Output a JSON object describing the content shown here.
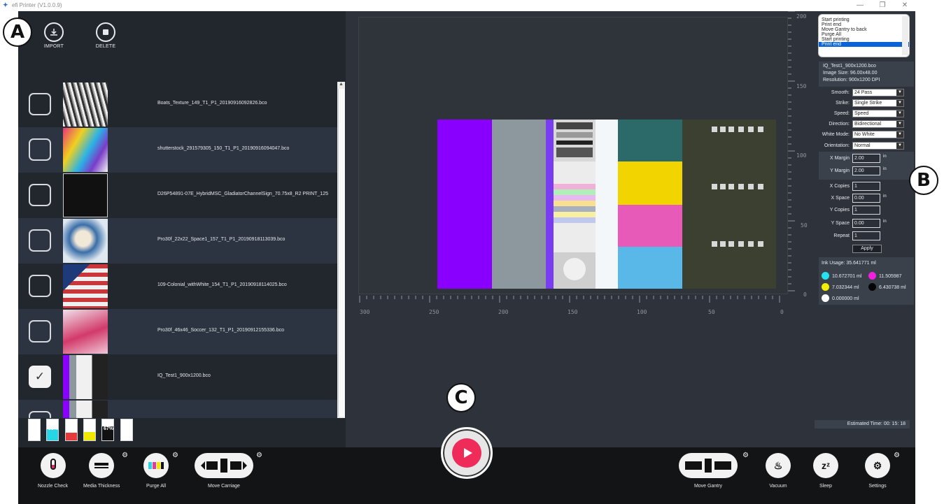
{
  "window": {
    "title": "efi Printer (V1.0.0.9)",
    "minimize": "—",
    "restore": "❐",
    "close": "✕",
    "logo": "✦"
  },
  "toolbar": {
    "import_label": "IMPORT",
    "delete_label": "DELETE",
    "import_icon": "download-icon",
    "delete_icon": "stop-square-icon"
  },
  "callouts": {
    "a": "A",
    "b": "B",
    "c": "C"
  },
  "files": [
    {
      "name": "Boats_Texture_149_T1_P1_20190916092826.bco",
      "checked": false,
      "check": ""
    },
    {
      "name": "shutterstock_291579305_150_T1_P1_20190916094047.bco",
      "checked": false,
      "check": ""
    },
    {
      "name": "D26P54891-07E_HybridMSC_GladiatorChannelSign_70.75x8_R2 PRINT_125",
      "checked": false,
      "check": ""
    },
    {
      "name": "Pro30f_22x22_Space1_157_T1_P1_20190918113039.bco",
      "checked": false,
      "check": ""
    },
    {
      "name": "109-Colonial_withWhite_154_T1_P1_20190918114025.bco",
      "checked": false,
      "check": ""
    },
    {
      "name": "Pro30f_46x46_Soccer_132_T1_P1_20190912155336.bco",
      "checked": false,
      "check": ""
    },
    {
      "name": "IQ_Test1_900x1200.bco",
      "checked": true,
      "check": "✓"
    },
    {
      "name": "",
      "checked": false,
      "check": ""
    }
  ],
  "ink_levels": [
    {
      "color": "#ffffff",
      "level": 0.95,
      "label": ""
    },
    {
      "color": "#26d6e6",
      "level": 0.53,
      "label": "53%"
    },
    {
      "color": "#e63a3a",
      "level": 0.38,
      "label": "38%"
    },
    {
      "color": "#f2e700",
      "level": 0.4,
      "label": "40%"
    },
    {
      "color": "#111111",
      "level": 0.67,
      "label": "67%"
    },
    {
      "color": "#ffffff",
      "level": 0.95,
      "label": ""
    }
  ],
  "rulers": {
    "h_ticks": [
      "300",
      "250",
      "200",
      "150",
      "100",
      "50",
      "0"
    ],
    "v_ticks": [
      "200",
      "150",
      "100",
      "50",
      "0"
    ]
  },
  "log": {
    "lines": [
      "Start printing",
      "Print end",
      "Move Gantry to back",
      "Purge All",
      "Start printing",
      "Print end"
    ],
    "selected_index": 5
  },
  "job": {
    "name": "IQ_Test1_900x1200.bco",
    "image_size_label": "Image Size:",
    "image_size": "96.00x48.00",
    "resolution_label": "Resolution:",
    "resolution": "900x1200 DPI"
  },
  "settings": [
    {
      "label": "Smooth:",
      "value": "24 Pass"
    },
    {
      "label": "Strike:",
      "value": "Single Strike"
    },
    {
      "label": "Speed:",
      "value": "Speed"
    },
    {
      "label": "Direction:",
      "value": "Bidirectional"
    },
    {
      "label": "White Mode:",
      "value": "No White"
    },
    {
      "label": "Orientation:",
      "value": "Normal"
    }
  ],
  "layout_fields": [
    {
      "label": "X Margin",
      "value": "2.00",
      "unit": "in"
    },
    {
      "label": "Y Margin",
      "value": "2.00",
      "unit": "in"
    },
    {
      "label": "X Copies",
      "value": "1",
      "unit": ""
    },
    {
      "label": "X Space",
      "value": "0.00",
      "unit": "in"
    },
    {
      "label": "Y Copies",
      "value": "1",
      "unit": ""
    },
    {
      "label": "Y Space",
      "value": "0.00",
      "unit": "in"
    },
    {
      "label": "Repeat",
      "value": "1",
      "unit": ""
    }
  ],
  "apply_label": "Apply",
  "ink_usage": {
    "title": "Ink Usage: 35.641771 ml",
    "cyan": "10.672701 ml",
    "magenta": "11.505987",
    "yellow": "7.032344 ml",
    "black": "6.430738 ml",
    "white": "0.000000 ml"
  },
  "estimated_time": "Estimated Time: 00: 15: 18",
  "bottom": {
    "nozzle_check": "Nozzle Check",
    "media_thickness": "Media Thickness",
    "purge_all": "Purge All",
    "move_carriage": "Move Carriage",
    "move_gantry": "Move Gantry",
    "vacuum": "Vacuum",
    "sleep": "Sleep",
    "settings": "Settings",
    "vacuum_glyph": "♨",
    "sleep_glyph": "zᶻ",
    "settings_glyph": "⚙",
    "gear_glyph": "⚙"
  },
  "colors": {
    "accent": "#ee2b59",
    "panel": "#2e333b",
    "bar": "#121416"
  }
}
